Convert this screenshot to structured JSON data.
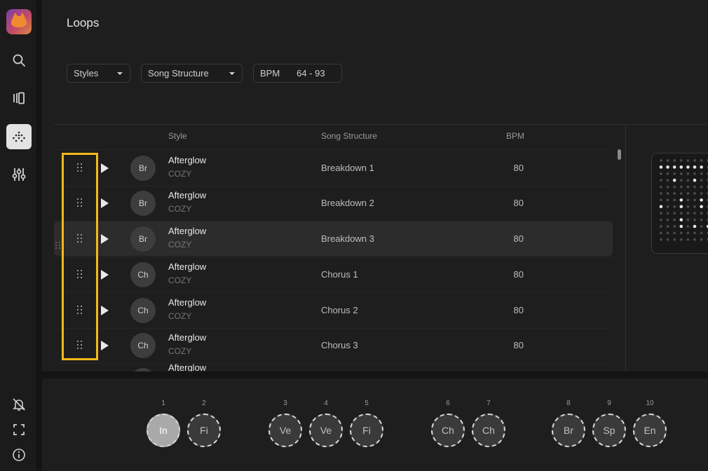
{
  "page": {
    "title": "Loops"
  },
  "filters": {
    "styles_label": "Styles",
    "structure_label": "Song Structure",
    "bpm_label": "BPM",
    "bpm_range": "64 - 93"
  },
  "table": {
    "headers": {
      "style": "Style",
      "structure": "Song Structure",
      "bpm": "BPM"
    },
    "rows": [
      {
        "badge": "Br",
        "style": "Afterglow",
        "sub": "COZY",
        "structure": "Breakdown 1",
        "bpm": "80"
      },
      {
        "badge": "Br",
        "style": "Afterglow",
        "sub": "COZY",
        "structure": "Breakdown 2",
        "bpm": "80"
      },
      {
        "badge": "Br",
        "style": "Afterglow",
        "sub": "COZY",
        "structure": "Breakdown 3",
        "bpm": "80"
      },
      {
        "badge": "Ch",
        "style": "Afterglow",
        "sub": "COZY",
        "structure": "Chorus 1",
        "bpm": "80"
      },
      {
        "badge": "Ch",
        "style": "Afterglow",
        "sub": "COZY",
        "structure": "Chorus 2",
        "bpm": "80"
      },
      {
        "badge": "Ch",
        "style": "Afterglow",
        "sub": "COZY",
        "structure": "Chorus 3",
        "bpm": "80"
      },
      {
        "badge": "",
        "style": "Afterglow",
        "sub": "",
        "structure": "",
        "bpm": ""
      }
    ]
  },
  "timeline": [
    {
      "num": "1",
      "label": "In"
    },
    {
      "num": "2",
      "label": "Fi"
    },
    {
      "num": "3",
      "label": "Ve"
    },
    {
      "num": "4",
      "label": "Ve"
    },
    {
      "num": "5",
      "label": "Fi"
    },
    {
      "num": "6",
      "label": "Ch"
    },
    {
      "num": "7",
      "label": "Ch"
    },
    {
      "num": "8",
      "label": "Br"
    },
    {
      "num": "9",
      "label": "Sp"
    },
    {
      "num": "10",
      "label": "En"
    }
  ],
  "sidebar_icons": [
    "search-icon",
    "library-icon",
    "pattern-icon",
    "mixer-icon",
    "notifications-off-icon",
    "fullscreen-icon",
    "info-icon"
  ],
  "colors": {
    "highlight": "#f5b81c",
    "active_nav": "#e3e3e3",
    "active_slot": "#a9a9a9"
  }
}
